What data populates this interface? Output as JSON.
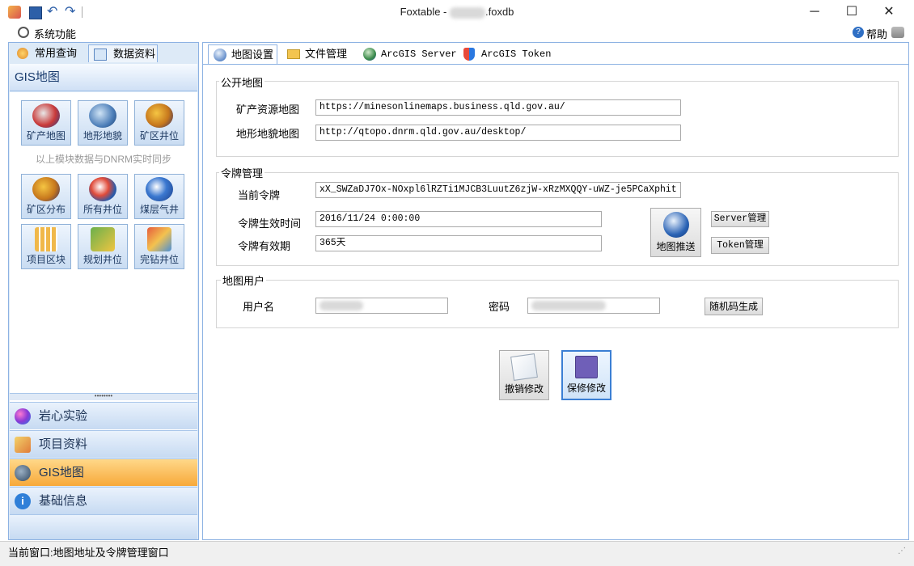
{
  "window": {
    "title_prefix": "Foxtable - ",
    "title_suffix": ".foxdb",
    "minimize": "─",
    "maximize": "☐",
    "close": "✕"
  },
  "menubar": {
    "system": "系统功能",
    "help": "帮助"
  },
  "left_tabs": [
    "常用查询",
    "数据资料"
  ],
  "gis_header": "GIS地图",
  "tiles_row1": [
    "矿产地图",
    "地形地貌",
    "矿区井位"
  ],
  "sync_note": "以上模块数据与DNRM实时同步",
  "tiles_row2": [
    "矿区分布",
    "所有井位",
    "煤层气井"
  ],
  "tiles_row3": [
    "项目区块",
    "规划井位",
    "完钻井位"
  ],
  "nav": [
    "岩心实验",
    "项目资料",
    "GIS地图",
    "基础信息"
  ],
  "right_tabs": [
    "地图设置",
    "文件管理",
    "ArcGIS Server",
    "ArcGIS Token"
  ],
  "public_map": {
    "title": "公开地图",
    "mineral_label": "矿产资源地图",
    "mineral_url": "https://minesonlinemaps.business.qld.gov.au/",
    "terrain_label": "地形地貌地图",
    "terrain_url": "http://qtopo.dnrm.qld.gov.au/desktop/"
  },
  "token": {
    "title": "令牌管理",
    "current_label": "当前令牌",
    "current_value": "xX_SWZaDJ7Ox-NOxpl6lRZTi1MJCB3LuutZ6zjW-xRzMXQQY-uWZ-je5PCaXphit",
    "effective_label": "令牌生效时间",
    "effective_value": "2016/11/24 0:00:00",
    "validity_label": "令牌有效期",
    "validity_value": "365天",
    "push_button": "地图推送",
    "server_button": "Server管理",
    "token_button": "Token管理"
  },
  "map_user": {
    "title": "地图用户",
    "username_label": "用户名",
    "password_label": "密码",
    "random_button": "随机码生成"
  },
  "actions": {
    "cancel": "撤销修改",
    "save": "保修修改"
  },
  "status": {
    "text": "当前窗口:地图地址及令牌管理窗口"
  }
}
